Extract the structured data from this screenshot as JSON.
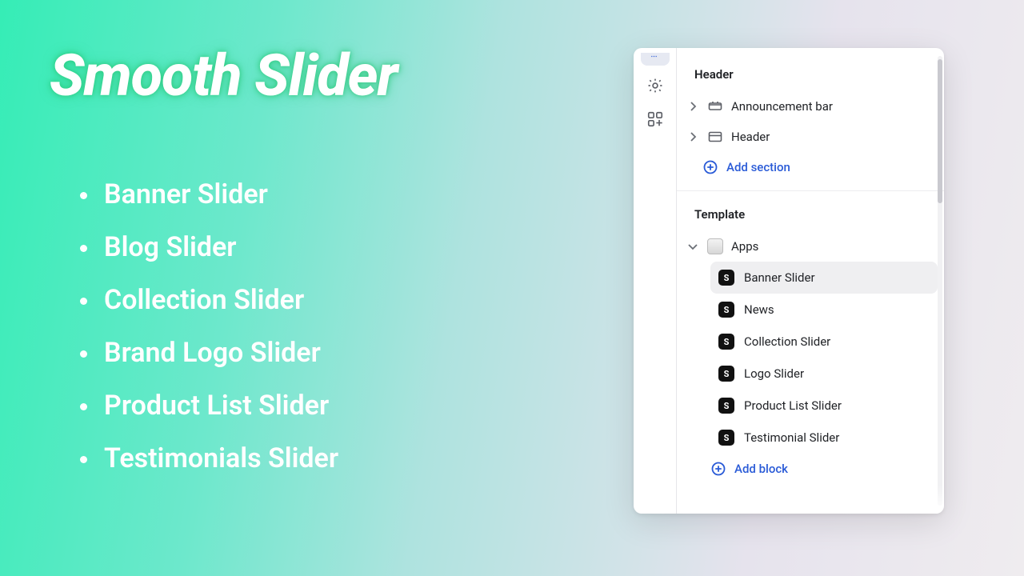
{
  "hero": {
    "title": "Smooth Slider",
    "features": [
      "Banner Slider",
      "Blog Slider",
      "Collection Slider",
      "Brand Logo Slider",
      "Product List Slider",
      "Testimonials Slider"
    ]
  },
  "panel": {
    "header_group": {
      "title": "Header",
      "items": [
        {
          "label": "Announcement bar"
        },
        {
          "label": "Header"
        }
      ],
      "add_label": "Add section"
    },
    "template_group": {
      "title": "Template",
      "apps_label": "Apps",
      "blocks": [
        {
          "label": "Banner Slider",
          "selected": true
        },
        {
          "label": "News",
          "selected": false
        },
        {
          "label": "Collection Slider",
          "selected": false
        },
        {
          "label": "Logo Slider",
          "selected": false
        },
        {
          "label": "Product List Slider",
          "selected": false
        },
        {
          "label": "Testimonial Slider",
          "selected": false
        }
      ],
      "add_block_label": "Add block",
      "block_badge_glyph": "S"
    }
  },
  "colors": {
    "link_blue": "#2a5bd7"
  }
}
